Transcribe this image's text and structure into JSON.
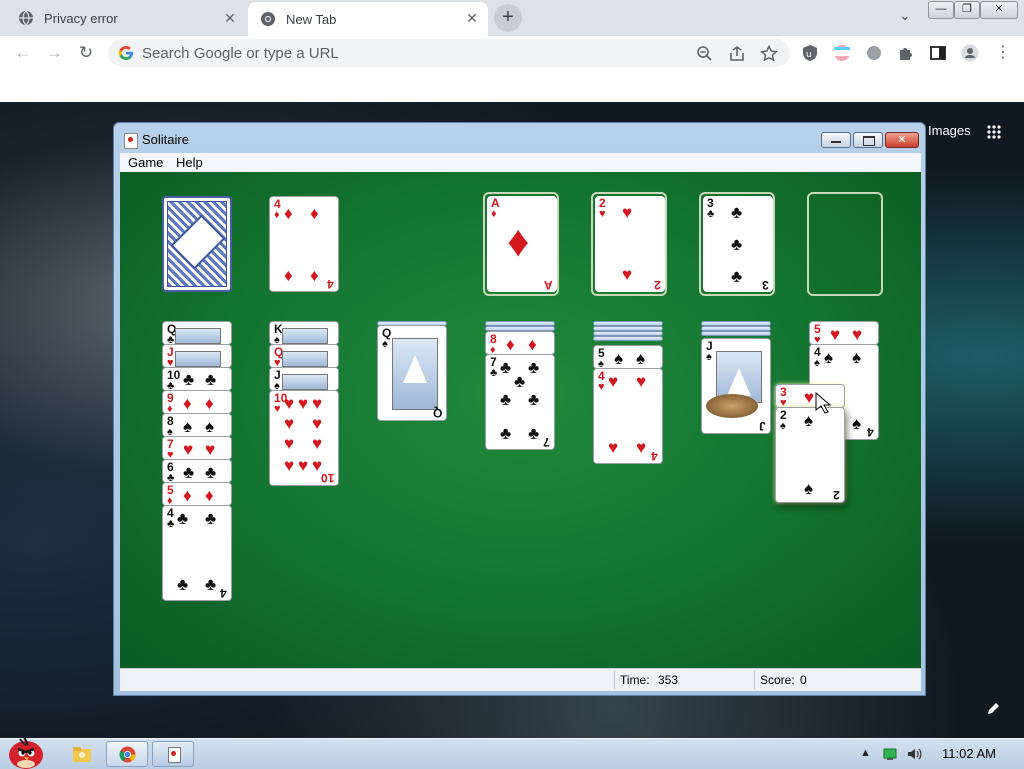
{
  "browser": {
    "tabs": [
      {
        "label": "Privacy error",
        "active": false
      },
      {
        "label": "New Tab",
        "active": true
      }
    ],
    "omnibox_placeholder": "Search Google or type a URL",
    "new_tab_link": "Images"
  },
  "solitaire": {
    "title": "Solitaire",
    "menu": [
      "Game",
      "Help"
    ],
    "status": {
      "time_label": "Time:",
      "time_value": "353",
      "score_label": "Score:",
      "score_value": "0"
    },
    "stock": {
      "face_down": true
    },
    "waste_top": {
      "rank": "4",
      "suit": "diamonds"
    },
    "foundations": [
      {
        "rank": "A",
        "suit": "diamonds"
      },
      {
        "rank": "2",
        "suit": "hearts"
      },
      {
        "rank": "3",
        "suit": "clubs"
      },
      {
        "rank": "",
        "suit": "empty"
      }
    ],
    "tableau": [
      {
        "visible": [
          "Q♣",
          "J♥",
          "10♣",
          "9♦",
          "8♠",
          "7♥",
          "6♣",
          "5♦",
          "4♣"
        ]
      },
      {
        "visible": [
          "K♠",
          "Q♥",
          "J♠",
          "10♥"
        ]
      },
      {
        "visible": [
          "Q♠"
        ]
      },
      {
        "visible": [
          "8♦",
          "7♣"
        ]
      },
      {
        "visible": [
          "5♠",
          "4♥"
        ]
      },
      {
        "visible": [
          "J♠"
        ]
      },
      {
        "visible": [
          "5♥",
          "4♠"
        ]
      }
    ],
    "dragging": [
      {
        "rank": "3",
        "suit": "hearts"
      },
      {
        "rank": "2",
        "suit": "spades"
      }
    ]
  },
  "taskbar": {
    "clock": "11:02 AM"
  },
  "colors": {
    "felt": "#137330",
    "red_suit": "#d4181f",
    "black_suit": "#111111",
    "chrome_tabstrip": "#dee1e6"
  }
}
